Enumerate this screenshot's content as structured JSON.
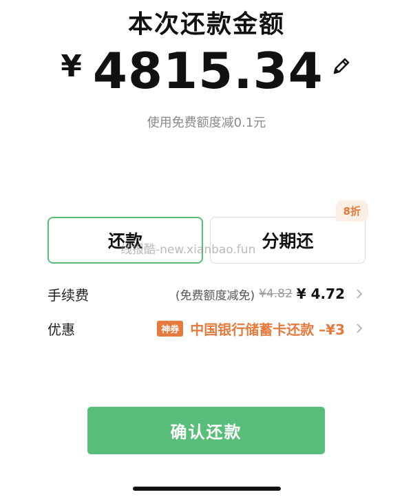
{
  "header": {
    "title": "本次还款金额",
    "currency": "¥",
    "amount": "4815.34",
    "discount_note": "使用免费额度减0.1元"
  },
  "options": {
    "repay_label": "还款",
    "installment_label": "分期还",
    "installment_badge": "8折"
  },
  "fee": {
    "label": "手续费",
    "note": "(免费额度减免)",
    "original": "¥4.82",
    "final": "¥ 4.72"
  },
  "promo": {
    "label": "优惠",
    "tag": "神券",
    "text": "中国银行储蓄卡还款 –¥3"
  },
  "confirm_label": "确认还款",
  "watermark": "线报酷-new.xianbao.fun",
  "colors": {
    "accent_green": "#58bd78",
    "promo_orange": "#e57a3c",
    "badge_bg": "#fbeee4"
  },
  "icons": {
    "edit": "pencil-icon",
    "chevron": "chevron-right-icon"
  }
}
